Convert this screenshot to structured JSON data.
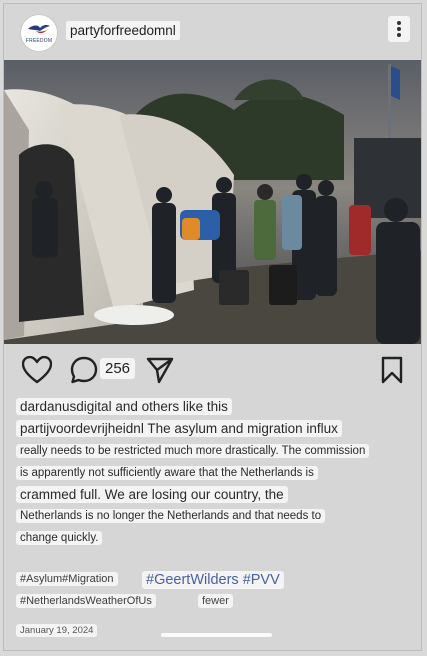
{
  "post": {
    "username": "partyforfreedomnl",
    "avatar_text": "FREEDOM",
    "photo_alt": "",
    "comment_count": "256",
    "liked_by": "dardanusdigital and others like this",
    "caption_lines": [
      "partijvoordevrijheidnl The asylum and migration influx",
      "really needs to be restricted much more drastically. The commission",
      "is apparently not sufficiently aware that the Netherlands is",
      "crammed full. We are losing our country, the",
      "Netherlands is no longer the Netherlands and that needs to",
      "change quickly."
    ],
    "hashtags_1": "#Asylum#Migration",
    "hashtags_2": "#GeertWilders #PVV",
    "hashtags_3": "#NetherlandsWeatherOfUs",
    "fewer_label": "fewer",
    "date": "January 19, 2024"
  },
  "icons": {
    "menu": "kebab-icon",
    "like": "heart-icon",
    "comment": "comment-icon",
    "share": "send-icon",
    "save": "bookmark-icon"
  },
  "colors": {
    "background": "#d9d9d9",
    "text_box": "#f4f4f4",
    "hashtag_accent": "#4a5fa4"
  }
}
